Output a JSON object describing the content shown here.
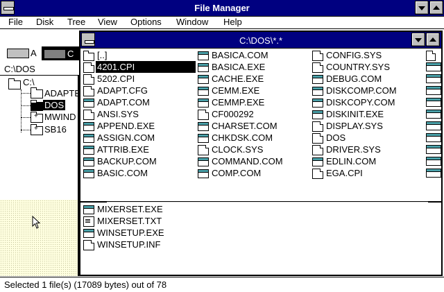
{
  "window": {
    "title": "File Manager"
  },
  "menu": [
    "File",
    "Disk",
    "Tree",
    "View",
    "Options",
    "Window",
    "Help"
  ],
  "drives": [
    {
      "letter": "A",
      "selected": false
    },
    {
      "letter": "C",
      "selected": true
    }
  ],
  "current_path": "C:\\DOS",
  "tree": {
    "root": "C:\\",
    "items": [
      {
        "label": "ADAPTE",
        "selected": false,
        "expandable": false
      },
      {
        "label": "DOS",
        "selected": true,
        "expandable": false
      },
      {
        "label": "MWIND",
        "selected": false,
        "expandable": true
      },
      {
        "label": "SB16",
        "selected": false,
        "expandable": true
      }
    ]
  },
  "child_window": {
    "title": "C:\\DOS\\*.*"
  },
  "files": {
    "columns": [
      [
        {
          "name": "[..]",
          "icon": "folder-icon"
        },
        {
          "name": "4201.CPI",
          "icon": "document-icon",
          "selected": true
        },
        {
          "name": "5202.CPI",
          "icon": "document-icon"
        },
        {
          "name": "ADAPT.CFG",
          "icon": "document-icon"
        },
        {
          "name": "ADAPT.COM",
          "icon": "program-icon"
        },
        {
          "name": "ANSI.SYS",
          "icon": "document-icon"
        },
        {
          "name": "APPEND.EXE",
          "icon": "program-icon"
        },
        {
          "name": "ASSIGN.COM",
          "icon": "program-icon"
        },
        {
          "name": "ATTRIB.EXE",
          "icon": "program-icon"
        },
        {
          "name": "BACKUP.COM",
          "icon": "program-icon"
        },
        {
          "name": "BASIC.COM",
          "icon": "program-icon"
        }
      ],
      [
        {
          "name": "BASICA.COM",
          "icon": "program-icon"
        },
        {
          "name": "BASICA.EXE",
          "icon": "program-icon"
        },
        {
          "name": "CACHE.EXE",
          "icon": "program-icon"
        },
        {
          "name": "CEMM.EXE",
          "icon": "program-icon"
        },
        {
          "name": "CEMMP.EXE",
          "icon": "program-icon"
        },
        {
          "name": "CF000292",
          "icon": "document-icon"
        },
        {
          "name": "CHARSET.COM",
          "icon": "program-icon"
        },
        {
          "name": "CHKDSK.COM",
          "icon": "program-icon"
        },
        {
          "name": "CLOCK.SYS",
          "icon": "document-icon"
        },
        {
          "name": "COMMAND.COM",
          "icon": "program-icon"
        },
        {
          "name": "COMP.COM",
          "icon": "program-icon"
        }
      ],
      [
        {
          "name": "CONFIG.SYS",
          "icon": "document-icon"
        },
        {
          "name": "COUNTRY.SYS",
          "icon": "document-icon"
        },
        {
          "name": "DEBUG.COM",
          "icon": "program-icon"
        },
        {
          "name": "DISKCOMP.COM",
          "icon": "program-icon"
        },
        {
          "name": "DISKCOPY.COM",
          "icon": "program-icon"
        },
        {
          "name": "DISKINIT.EXE",
          "icon": "program-icon"
        },
        {
          "name": "DISPLAY.SYS",
          "icon": "document-icon"
        },
        {
          "name": "DOS",
          "icon": "document-icon"
        },
        {
          "name": "DRIVER.SYS",
          "icon": "document-icon"
        },
        {
          "name": "EDLIN.COM",
          "icon": "program-icon"
        },
        {
          "name": "EGA.CPI",
          "icon": "document-icon"
        }
      ]
    ],
    "partial_column_icons": [
      "document-icon",
      "program-icon",
      "program-icon",
      "program-icon",
      "program-icon",
      "program-icon",
      "program-icon",
      "program-icon",
      "program-icon",
      "program-icon",
      "program-icon"
    ]
  },
  "lower_files": [
    {
      "name": "MIXERSET.EXE",
      "icon": "program-icon"
    },
    {
      "name": "MIXERSET.TXT",
      "icon": "text-document-icon"
    },
    {
      "name": "WINSETUP.EXE",
      "icon": "program-icon"
    },
    {
      "name": "WINSETUP.INF",
      "icon": "document-icon"
    }
  ],
  "status": {
    "text": "Selected 1 file(s) (17089 bytes) out of 78"
  },
  "colors": {
    "titlebar": "#000080",
    "program_icon_band": "#4aa0a8",
    "tree_background": "#ffffe0"
  }
}
